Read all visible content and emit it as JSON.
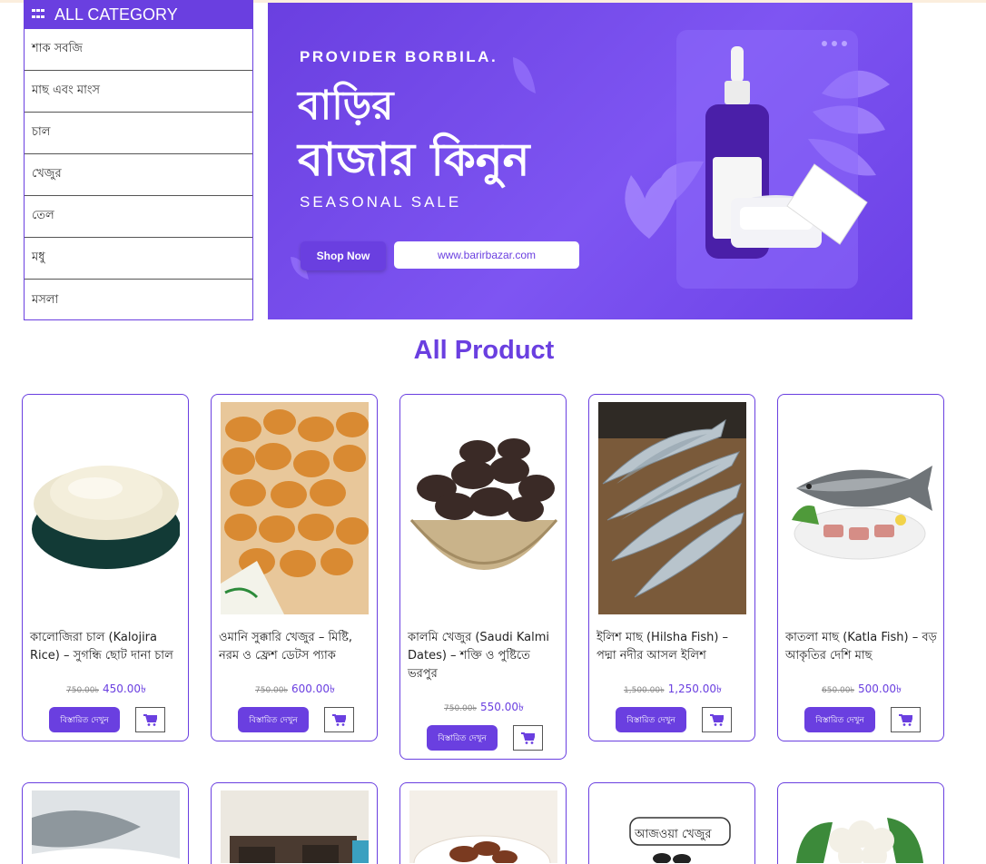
{
  "sidebar": {
    "header": "ALL CATEGORY",
    "items": [
      "শাক সবজি",
      "মাছ এবং মাংস",
      "চাল",
      "খেজুর",
      "তেল",
      "মধু",
      "মসলা"
    ]
  },
  "banner": {
    "subtitle": "PROVIDER BORBILA.",
    "title_line1": "বাড়ির",
    "title_line2": "বাজার কিনুন",
    "tagline": "SEASONAL SALE",
    "shop_button": "Shop Now",
    "url": "www.barirbazar.com"
  },
  "section_title": "All Product",
  "products": [
    {
      "title": "কালোজিরা চাল (Kalojira Rice) – সুগন্ধি ছোট দানা চাল",
      "old_price": "750.00৳",
      "new_price": "450.00৳",
      "details_label": "বিস্তারিত দেখুন"
    },
    {
      "title": "ওমানি সুক্কারি খেজুর – মিষ্টি, নরম ও ফ্রেশ ডেটস প্যাক",
      "old_price": "750.00৳",
      "new_price": "600.00৳",
      "details_label": "বিস্তারিত দেখুন"
    },
    {
      "title": "কালমি খেজুর (Saudi Kalmi Dates) – শক্তি ও পুষ্টিতে ভরপুর",
      "old_price": "750.00৳",
      "new_price": "550.00৳",
      "details_label": "বিস্তারিত দেখুন"
    },
    {
      "title": "ইলিশ মাছ (Hilsha Fish) – পদ্মা নদীর আসল ইলিশ",
      "old_price": "1,500.00৳",
      "new_price": "1,250.00৳",
      "details_label": "বিস্তারিত দেখুন"
    },
    {
      "title": "কাতলা মাছ (Katla Fish) – বড় আকৃতির দেশি মাছ",
      "old_price": "650.00৳",
      "new_price": "500.00৳",
      "details_label": "বিস্তারিত দেখুন"
    }
  ],
  "second_row": [
    {
      "image_text": ""
    },
    {
      "image_text": ""
    },
    {
      "image_text": ""
    },
    {
      "image_text": "আজওয়া খেজুর"
    },
    {
      "image_text": ""
    }
  ],
  "colors": {
    "accent": "#6a3fe0",
    "banner_bg": "#7b55f0"
  }
}
